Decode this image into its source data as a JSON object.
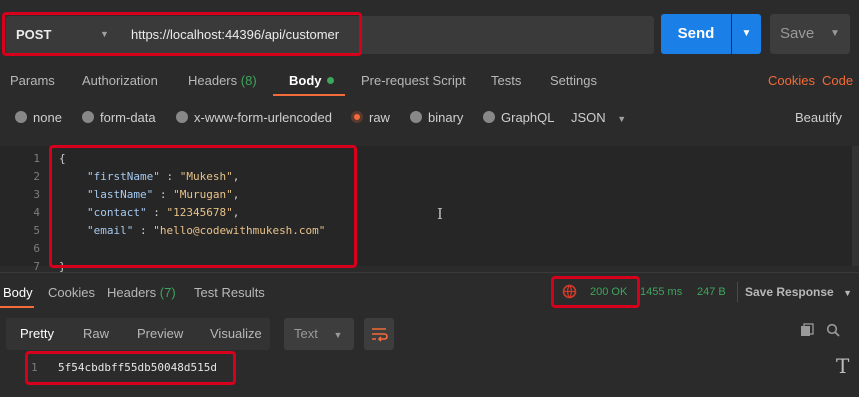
{
  "request": {
    "method": "POST",
    "url": "https://localhost:44396/api/customer",
    "send_label": "Send",
    "save_label": "Save"
  },
  "request_tabs": {
    "params": "Params",
    "authorization": "Authorization",
    "headers": "Headers",
    "headers_count": "(8)",
    "body": "Body",
    "prerequest": "Pre-request Script",
    "tests": "Tests",
    "settings": "Settings",
    "cookies": "Cookies",
    "code": "Code"
  },
  "body_types": {
    "none": "none",
    "form_data": "form-data",
    "urlencoded": "x-www-form-urlencoded",
    "raw": "raw",
    "binary": "binary",
    "graphql": "GraphQL",
    "format": "JSON",
    "beautify": "Beautify",
    "selected": "raw"
  },
  "editor": {
    "line_numbers": [
      "1",
      "2",
      "3",
      "4",
      "5",
      "6",
      "7"
    ],
    "open_brace": "{",
    "close_brace": "}",
    "fields": [
      {
        "key": "\"firstName\"",
        "sep": " : ",
        "value": "\"Mukesh\"",
        "end": ","
      },
      {
        "key": "\"lastName\"",
        "sep": " : ",
        "value": "\"Murugan\"",
        "end": ","
      },
      {
        "key": "\"contact\"",
        "sep": " : ",
        "value": "\"12345678\"",
        "end": ","
      },
      {
        "key": "\"email\"",
        "sep": " : ",
        "value": "\"hello@codewithmukesh.com\"",
        "end": ""
      }
    ]
  },
  "response_tabs": {
    "body": "Body",
    "cookies": "Cookies",
    "headers": "Headers",
    "headers_count": "(7)",
    "test_results": "Test Results"
  },
  "response_status": {
    "status": "200 OK",
    "time": "1455 ms",
    "size": "247 B",
    "save_response": "Save Response"
  },
  "response_view": {
    "pretty": "Pretty",
    "raw": "Raw",
    "preview": "Preview",
    "visualize": "Visualize",
    "format": "Text",
    "line_number": "1",
    "content": "5f54cbdbff55db50048d515d"
  },
  "colors": {
    "accent": "#f26b3a",
    "send": "#1a80e8",
    "success": "#3ea55d",
    "highlight": "#d6001c"
  }
}
